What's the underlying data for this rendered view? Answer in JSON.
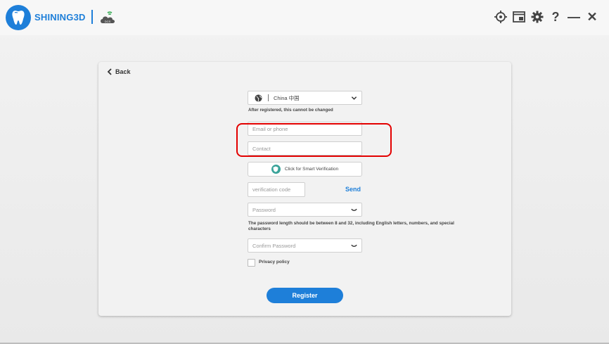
{
  "header": {
    "brand": "SHINING3D",
    "brand_color": "#1e7fd9",
    "cloud_label": "DCS",
    "controls": [
      {
        "icon": "target-icon"
      },
      {
        "icon": "window-icon"
      },
      {
        "icon": "gear-icon"
      },
      {
        "icon": "help-icon",
        "glyph": "?"
      },
      {
        "icon": "minimize-icon",
        "glyph": "—"
      },
      {
        "icon": "close-icon",
        "glyph": "✕"
      }
    ]
  },
  "form": {
    "back_label": "Back",
    "country": {
      "value": "China 中国",
      "hint": "After registered, this cannot be changed"
    },
    "email_placeholder": "Email or phone",
    "contact_placeholder": "Contact",
    "smart_verification_label": "Click for Smart Verification",
    "verification_code_placeholder": "verification code",
    "send_label": "Send",
    "password_placeholder": "Password",
    "password_hint": "The password length should be between 8 and 32, including English letters, numbers, and special characters",
    "confirm_password_placeholder": "Confirm Password",
    "privacy_label": "Privacy policy",
    "register_label": "Register"
  },
  "highlight_color": "#e30000"
}
